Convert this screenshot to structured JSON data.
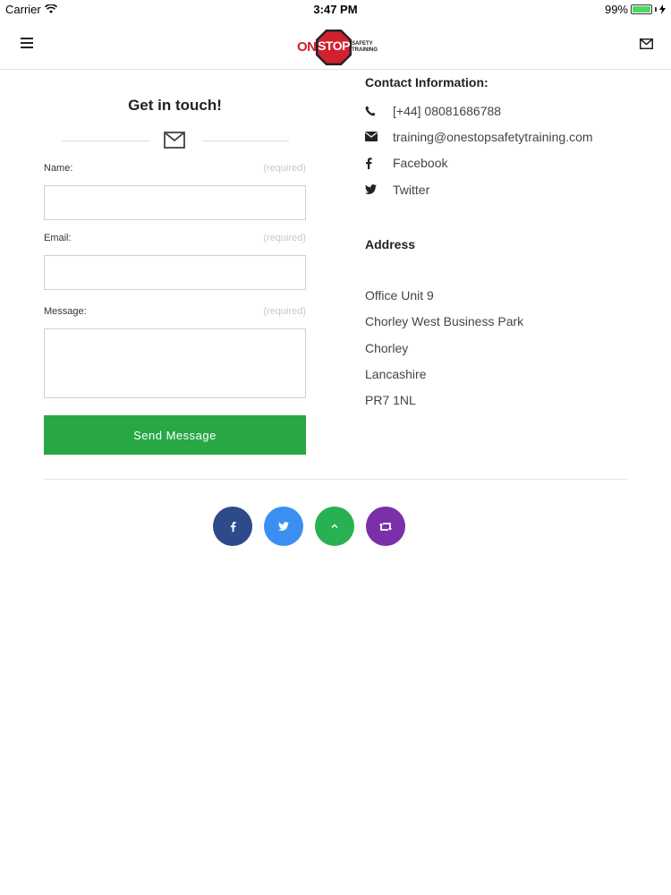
{
  "status_bar": {
    "carrier": "Carrier",
    "time": "3:47 PM",
    "battery_percent": "99%",
    "battery_level": 0.99
  },
  "header": {
    "logo_text_one": "ONE",
    "logo_text_stop": "STOP",
    "logo_text_sub1": "SAFETY",
    "logo_text_sub2": "TRAINING"
  },
  "form": {
    "title": "Get in touch!",
    "name_label": "Name:",
    "email_label": "Email:",
    "message_label": "Message:",
    "required_hint": "(required)",
    "name_value": "",
    "email_value": "",
    "message_value": "",
    "send_label": "Send Message"
  },
  "contact": {
    "heading": "Contact Information:",
    "phone": "[+44] 08081686788",
    "email": "training@onestopsafetytraining.com",
    "facebook": "Facebook",
    "twitter": "Twitter"
  },
  "address": {
    "heading": "Address",
    "lines": [
      "Office Unit 9",
      "Chorley West Business Park",
      "Chorley",
      "Lancashire",
      "PR7 1NL"
    ]
  },
  "colors": {
    "send_button": "#28a745",
    "facebook": "#2d4a8a",
    "twitter": "#3b8ff0",
    "top": "#28b150",
    "share": "#7a30a8",
    "logo_red": "#d2202f"
  },
  "icons": [
    "hamburger-icon",
    "mail-icon",
    "envelope-icon",
    "phone-icon",
    "facebook-icon",
    "twitter-icon",
    "chevron-up-icon",
    "retweet-icon"
  ]
}
